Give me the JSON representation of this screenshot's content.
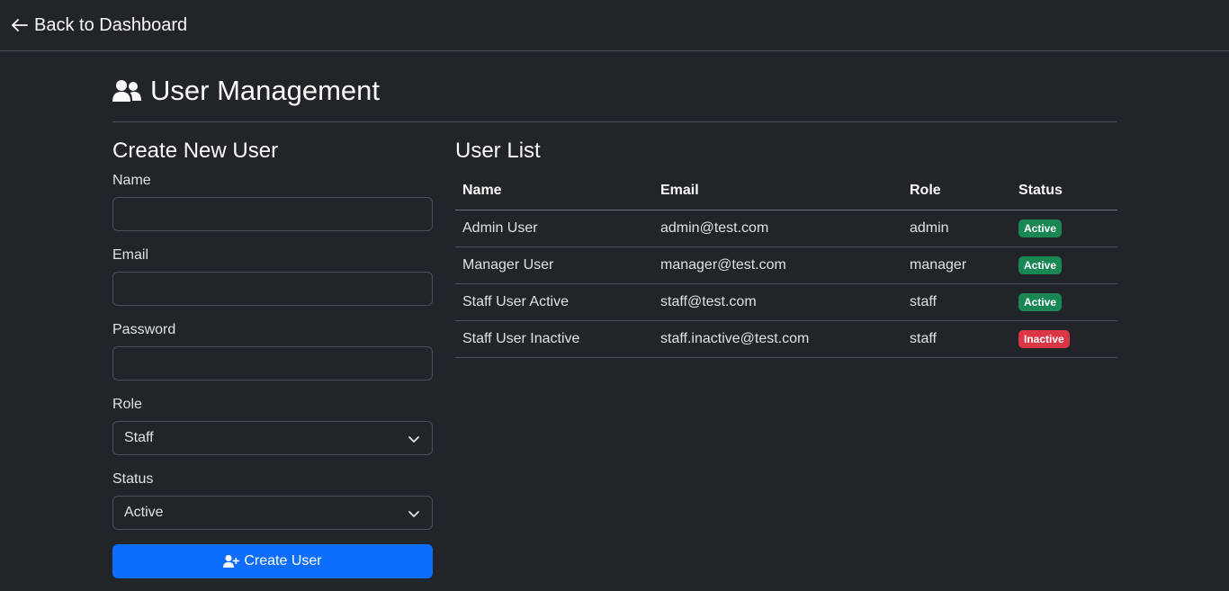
{
  "nav": {
    "back_label": "Back to Dashboard"
  },
  "page": {
    "title": "User Management"
  },
  "form": {
    "heading": "Create New User",
    "name_label": "Name",
    "name_value": "",
    "email_label": "Email",
    "email_value": "",
    "password_label": "Password",
    "password_value": "",
    "role_label": "Role",
    "role_value": "Staff",
    "status_label": "Status",
    "status_value": "Active",
    "submit_label": "Create User"
  },
  "list": {
    "heading": "User List",
    "columns": [
      "Name",
      "Email",
      "Role",
      "Status"
    ],
    "rows": [
      {
        "name": "Admin User",
        "email": "admin@test.com",
        "role": "admin",
        "status": "Active"
      },
      {
        "name": "Manager User",
        "email": "manager@test.com",
        "role": "manager",
        "status": "Active"
      },
      {
        "name": "Staff User Active",
        "email": "staff@test.com",
        "role": "staff",
        "status": "Active"
      },
      {
        "name": "Staff User Inactive",
        "email": "staff.inactive@test.com",
        "role": "staff",
        "status": "Inactive"
      }
    ]
  },
  "colors": {
    "background": "#212529",
    "primary": "#0d6efd",
    "success": "#198754",
    "danger": "#dc3545"
  },
  "icons": {
    "back": "arrow-left-icon",
    "header": "users-icon",
    "submit": "user-plus-icon",
    "select": "chevron-down-icon"
  }
}
